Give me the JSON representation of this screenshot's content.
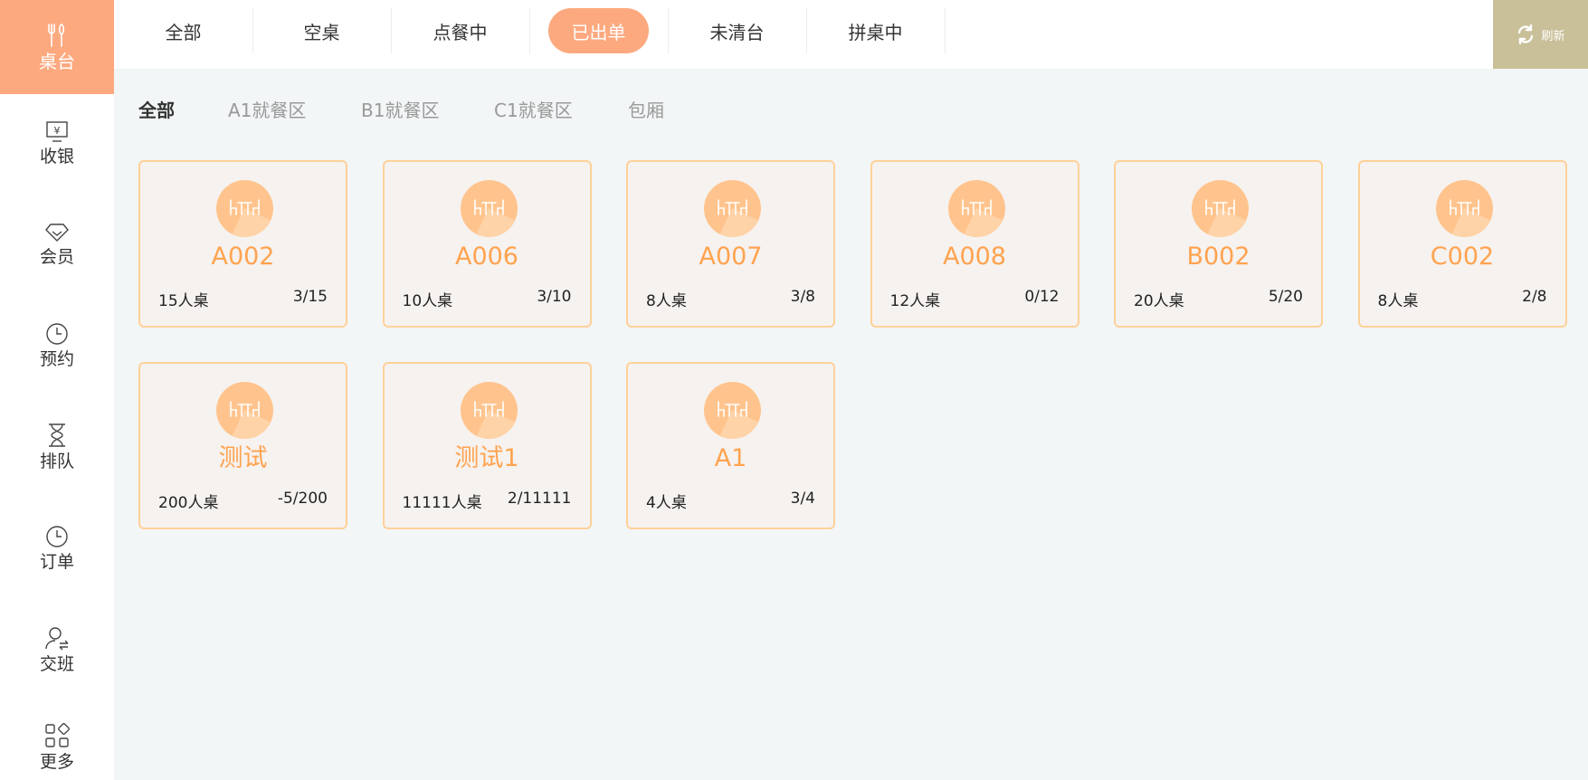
{
  "sidebar": {
    "items": [
      {
        "label": "桌台",
        "icon": "fork-knife-icon"
      },
      {
        "label": "收银",
        "icon": "cashier-icon"
      },
      {
        "label": "会员",
        "icon": "diamond-icon"
      },
      {
        "label": "预约",
        "icon": "clock-icon"
      },
      {
        "label": "排队",
        "icon": "hourglass-icon"
      },
      {
        "label": "订单",
        "icon": "clock-icon"
      },
      {
        "label": "交班",
        "icon": "user-switch-icon"
      },
      {
        "label": "更多",
        "icon": "grid-icon"
      }
    ],
    "active_index": 0
  },
  "tabs": {
    "items": [
      "全部",
      "空桌",
      "点餐中",
      "已出单",
      "未清台",
      "拼桌中"
    ],
    "active_index": 3
  },
  "refresh": {
    "label": "刷新",
    "icon": "refresh-icon"
  },
  "zones": {
    "items": [
      "全部",
      "A1就餐区",
      "B1就餐区",
      "C1就餐区",
      "包厢"
    ],
    "active_index": 0
  },
  "tables": [
    {
      "name": "A002",
      "capacity": "15人桌",
      "occupancy": "3/15"
    },
    {
      "name": "A006",
      "capacity": "10人桌",
      "occupancy": "3/10"
    },
    {
      "name": "A007",
      "capacity": "8人桌",
      "occupancy": "3/8"
    },
    {
      "name": "A008",
      "capacity": "12人桌",
      "occupancy": "0/12"
    },
    {
      "name": "B002",
      "capacity": "20人桌",
      "occupancy": "5/20"
    },
    {
      "name": "C002",
      "capacity": "8人桌",
      "occupancy": "2/8"
    },
    {
      "name": "测试",
      "capacity": "200人桌",
      "occupancy": "-5/200"
    },
    {
      "name": "测试1",
      "capacity": "11111人桌",
      "occupancy": "2/11111"
    },
    {
      "name": "A1",
      "capacity": "4人桌",
      "occupancy": "3/4"
    }
  ],
  "colors": {
    "accent": "#fda97f",
    "table_name": "#ffa350",
    "card_border": "#ffd199",
    "card_bg": "#f6f2ef",
    "refresh_bg": "#c9c09a"
  }
}
